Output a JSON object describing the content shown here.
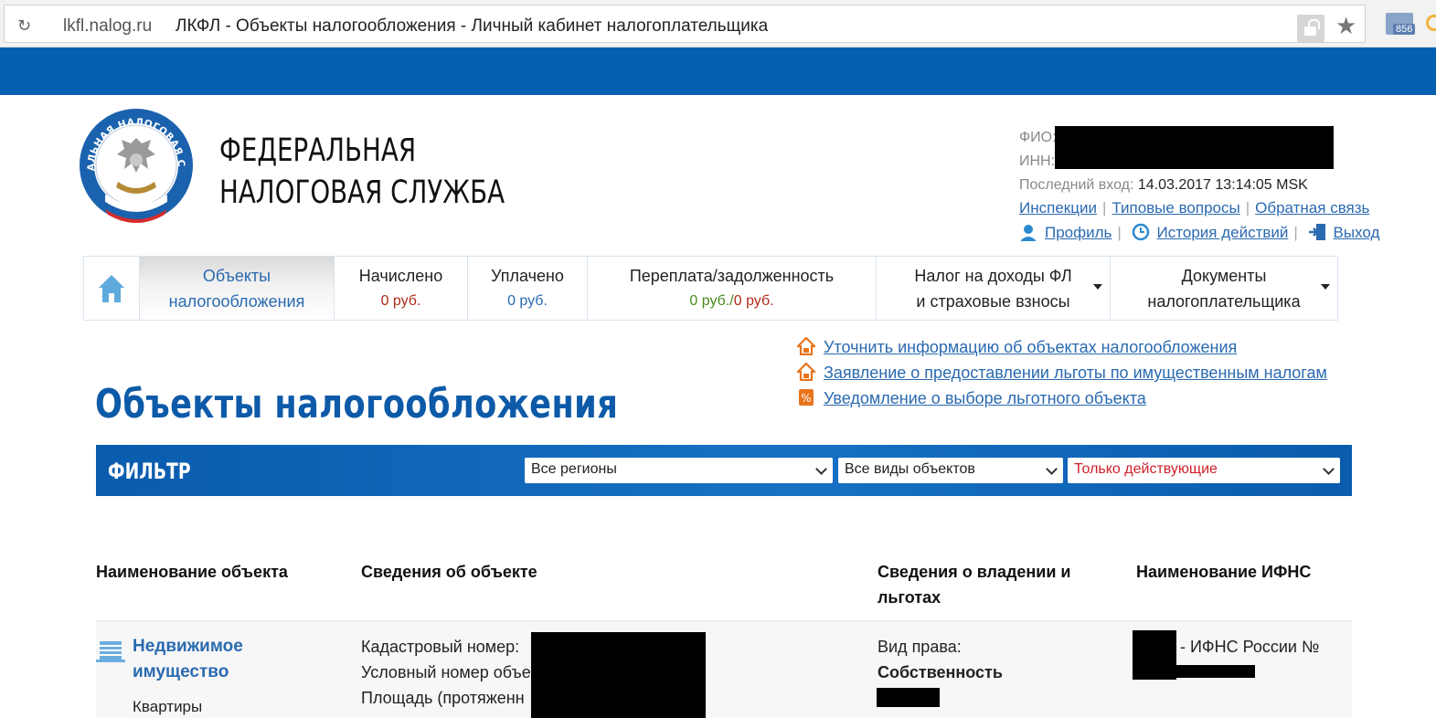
{
  "browser": {
    "url": "lkfl.nalog.ru",
    "title": "ЛКФЛ - Объекты налогообложения - Личный кабинет налогоплательщика",
    "mail_badge": "856"
  },
  "header": {
    "brand_line1": "ФЕДЕРАЛЬНАЯ",
    "brand_line2": "НАЛОГОВАЯ СЛУЖБА",
    "logo_text": "ФЕДЕРАЛЬНАЯ НАЛОГОВАЯ СЛУЖБА",
    "fio_label": "ФИО:",
    "inn_label": "ИНН:",
    "last_login_label": "Последний вход:",
    "last_login_value": "14.03.2017 13:14:05 MSK",
    "links": [
      "Инспекции",
      "Типовые вопросы",
      "Обратная связь"
    ],
    "profile": "Профиль",
    "history": "История действий",
    "logout": "Выход",
    "separator": "|"
  },
  "tabs": [
    {
      "line1": "Объекты",
      "line2": "налогообложения"
    },
    {
      "line1": "Начислено",
      "amount": "0 руб.",
      "amount_color": "#b02a1a"
    },
    {
      "line1": "Уплачено",
      "amount": "0 руб.",
      "amount_color": "#2a6ab0"
    },
    {
      "line1": "Переплата/задолженность",
      "amount_green": "0 руб.",
      "amount_sep": "/",
      "amount_red": "0 руб."
    },
    {
      "line1": "Налог на доходы ФЛ",
      "line2": "и страховые взносы"
    },
    {
      "line1": "Документы",
      "line2": "налогоплательщика"
    }
  ],
  "actions": [
    "Уточнить информацию об объектах налогообложения",
    "Заявление о предоставлении льготы по имущественным налогам",
    "Уведомление о выборе льготного объекта"
  ],
  "page_title": "Объекты налогообложения",
  "filter": {
    "label": "ФИЛЬТР",
    "region": "Все регионы",
    "object_type": "Все виды объектов",
    "status": "Только действующие",
    "status_color": "#d0202a"
  },
  "table": {
    "headers": [
      "Наименование объекта",
      "Сведения об объекте",
      "Сведения о владении и",
      "льготах",
      "Наименование ИФНС"
    ],
    "row": {
      "name_line1": "Недвижимое",
      "name_line2": "имущество",
      "subtype": "Квартиры",
      "cadastral_label": "Кадастровый номер:",
      "conditional_label": "Условный номер объе",
      "area_label": "Площадь (протяженн",
      "right_label": "Вид права:",
      "right_value": "Собственность",
      "ifns": "- ИФНС России №"
    }
  }
}
